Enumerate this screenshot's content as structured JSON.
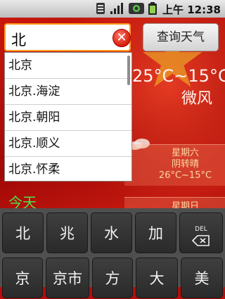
{
  "status_bar": {
    "time": "上午 12:38"
  },
  "search": {
    "value": "北",
    "clear_icon": "clear-icon",
    "query_button": "查询天气"
  },
  "weather": {
    "temperature": "25°C~15°C",
    "wind": "微风",
    "today_label": "今天"
  },
  "forecast": [
    {
      "day": "星期六",
      "condition": "阴转晴",
      "temperature": "26°C~15°C"
    },
    {
      "day": "星期日"
    }
  ],
  "suggestions": [
    "北京",
    "北京.海淀",
    "北京.朝阳",
    "北京.顺义",
    "北京.怀柔"
  ],
  "keyboard": {
    "row1": [
      "北",
      "兆",
      "水",
      "加"
    ],
    "delete_label": "DEL",
    "row2": [
      "京",
      "京市",
      "方",
      "大",
      "美"
    ]
  }
}
